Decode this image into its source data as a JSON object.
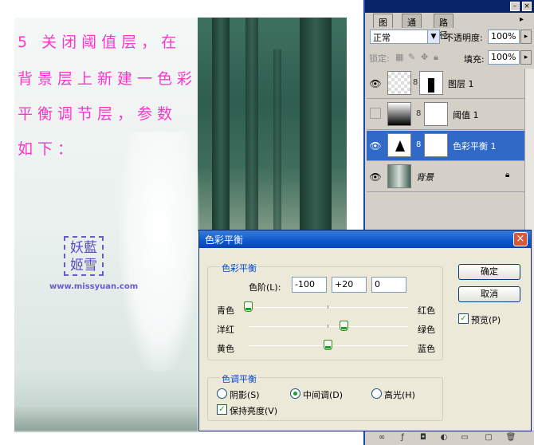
{
  "canvas": {
    "instruction_lines": [
      "5 关闭阈值层，在",
      "背景层上新建一色彩",
      "平衡调节层，参数",
      "如下："
    ],
    "seal_text": [
      "妖藍",
      "姬雪"
    ],
    "site": "www.missyuan.com"
  },
  "layers_panel": {
    "tabs": [
      "图层",
      "通道",
      "路径"
    ],
    "blend_mode": "正常",
    "opacity_label": "不透明度:",
    "opacity_value": "100%",
    "lock_label": "锁定:",
    "fill_label": "填充:",
    "fill_value": "100%",
    "layers": [
      {
        "name": "图层 1",
        "visible": true,
        "selected": false
      },
      {
        "name": "阈值 1",
        "visible": false,
        "selected": false
      },
      {
        "name": "色彩平衡 1",
        "visible": true,
        "selected": true
      },
      {
        "name": "背景",
        "visible": true,
        "selected": false
      }
    ]
  },
  "dialog": {
    "title": "色彩平衡",
    "group1_title": "色彩平衡",
    "levels_label": "色阶(L):",
    "levels": [
      "-100",
      "+20",
      "0"
    ],
    "sliders": [
      {
        "left": "青色",
        "right": "红色",
        "value": -100
      },
      {
        "left": "洋红",
        "right": "绿色",
        "value": 20
      },
      {
        "left": "黄色",
        "right": "蓝色",
        "value": 0
      }
    ],
    "group2_title": "色调平衡",
    "tones": [
      "阴影(S)",
      "中间调(D)",
      "高光(H)"
    ],
    "selected_tone": "中间调(D)",
    "preserve_luminosity": "保持亮度(V)",
    "ok": "确定",
    "cancel": "取消",
    "preview": "预览(P)"
  }
}
